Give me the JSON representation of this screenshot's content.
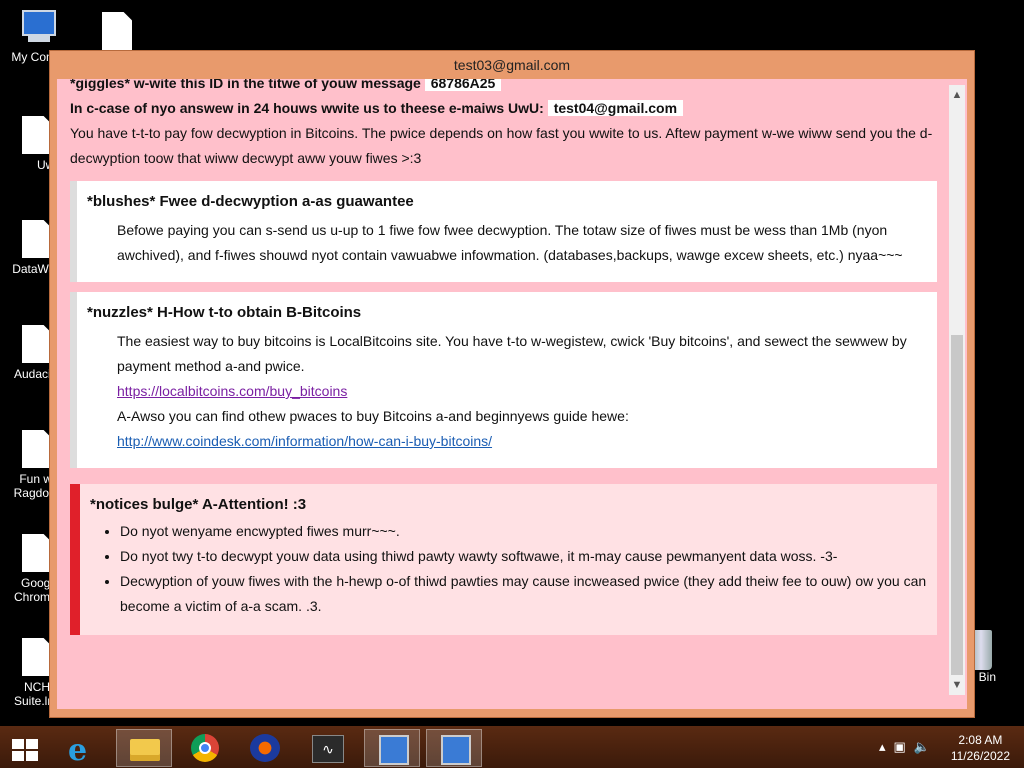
{
  "desktop": {
    "icons": [
      {
        "label": "My Comp"
      },
      {
        "label": ""
      },
      {
        "label": "UwU"
      },
      {
        "label": "DataWag"
      },
      {
        "label": "Audacity"
      },
      {
        "label": "Fun wi Ragdolls"
      },
      {
        "label": "Googl Chrome."
      },
      {
        "label": "NCH Suite.lnk"
      },
      {
        "label": "cle Bin"
      }
    ]
  },
  "window": {
    "title": "test03@gmail.com",
    "id_line": "*giggles* w-wite this ID in the titwe of youw message",
    "id_code": "68786A25",
    "contact_line": "In c-case of nyo answew in 24 houws wwite us to theese e-maiws UwU:",
    "contact_email": "test04@gmail.com",
    "intro_text": "You have t-t-to pay fow decwyption in Bitcoins. The pwice depends on how fast you wwite to us. Aftew payment w-we wiww send you the d-decwyption toow that wiww decwypt aww youw fiwes >:3",
    "guarantee": {
      "heading": "*blushes* Fwee d-decwyption a-as guawantee",
      "text": "Befowe paying you can s-send us u-up to 1 fiwe fow fwee decwyption. The totaw size of fiwes must be wess than 1Mb (nyon awchived), and f-fiwes shouwd nyot contain vawuabwe infowmation. (databases,backups, wawge excew sheets, etc.) nyaa~~~"
    },
    "howto": {
      "heading": "*nuzzles* H-How t-to obtain B-Bitcoins",
      "text1": "The easiest way to buy bitcoins is LocalBitcoins site. You have t-to w-wegistew, cwick 'Buy bitcoins', and sewect the sewwew by payment method a-and pwice.",
      "link1": "https://localbitcoins.com/buy_bitcoins",
      "text2": "A-Awso you can find othew pwaces to buy Bitcoins a-and beginnyews guide hewe:",
      "link2": "http://www.coindesk.com/information/how-can-i-buy-bitcoins/"
    },
    "attention": {
      "heading": "*notices bulge* A-Attention! :3",
      "items": [
        "Do nyot wenyame encwypted fiwes murr~~~.",
        "Do nyot twy t-to decwypt youw data using thiwd pawty wawty softwawe, it m-may cause pewmanyent data woss. -3-",
        "Decwyption of youw fiwes with the h-hewp o-of thiwd pawties may cause incweased pwice (they add theiw fee to ouw) ow you can become a victim of a-a scam. .3."
      ]
    }
  },
  "taskbar": {
    "apps": [
      "start-icon",
      "internet-explorer-icon",
      "file-explorer-icon",
      "chrome-icon",
      "audacity-icon",
      "wavepad-icon",
      "setup-icon",
      "setup-icon"
    ],
    "time": "2:08 AM",
    "date": "11/26/2022",
    "tray_icons": [
      "chevron-up-icon",
      "network-icon",
      "volume-icon"
    ]
  }
}
